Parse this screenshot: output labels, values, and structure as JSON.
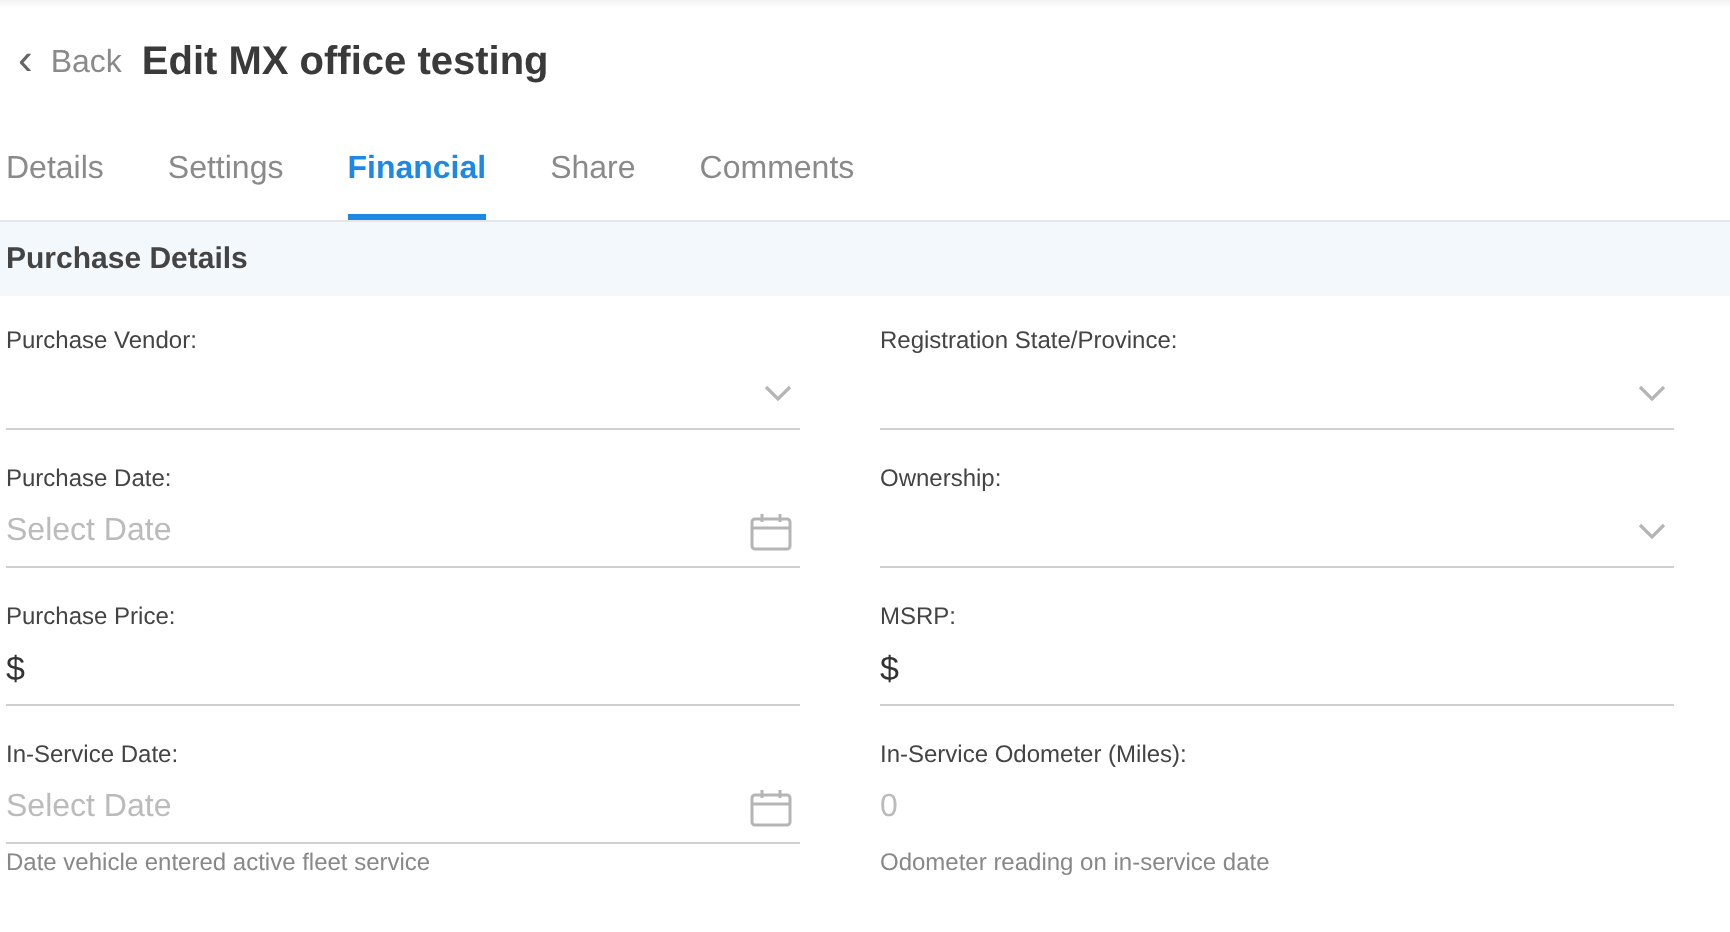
{
  "header": {
    "back": {
      "icon": "‹",
      "label": "Back"
    },
    "title": "Edit MX office testing"
  },
  "tabs": [
    {
      "label": "Details",
      "selected": false
    },
    {
      "label": "Settings",
      "selected": false
    },
    {
      "label": "Financial",
      "selected": true
    },
    {
      "label": "Share",
      "selected": false
    },
    {
      "label": "Comments",
      "selected": false
    }
  ],
  "section": {
    "title": "Purchase Details"
  },
  "fields": [
    {
      "kind": "select",
      "label": "Purchase Vendor:"
    },
    {
      "kind": "select",
      "label": "Registration State/Province:"
    },
    {
      "kind": "date",
      "label": "Purchase Date:",
      "placeholder": "Select Date"
    },
    {
      "kind": "select",
      "label": "Ownership:"
    },
    {
      "kind": "currency",
      "label": "Purchase Price:",
      "prefix": "$"
    },
    {
      "kind": "currency",
      "label": "MSRP:",
      "prefix": "$"
    },
    {
      "kind": "date",
      "label": "In-Service Date:",
      "placeholder": "Select Date",
      "hint": "Date vehicle entered active fleet service"
    },
    {
      "kind": "number",
      "label": "In-Service Odometer (Miles):",
      "placeholder": "0",
      "hint": "Odometer reading on in-service date"
    }
  ]
}
